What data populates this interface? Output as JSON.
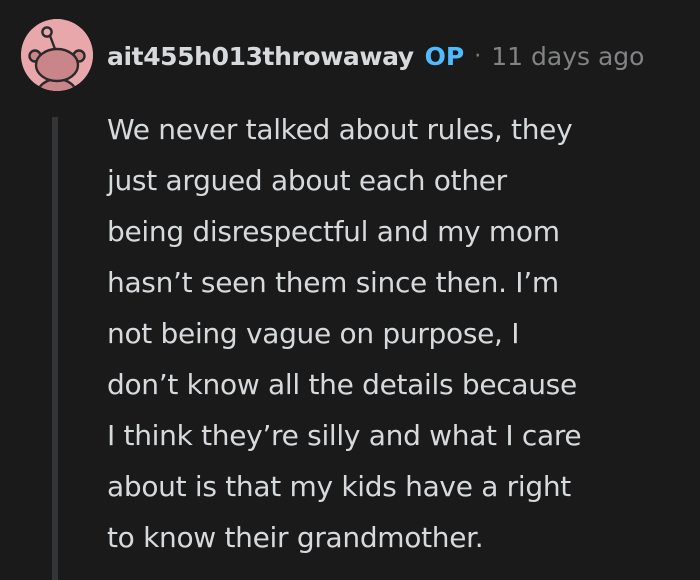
{
  "comment": {
    "author": "ait455h013throwaway",
    "badge": "OP",
    "separator": "·",
    "timestamp": "11 days ago",
    "avatar_icon": "reddit-snoo-icon",
    "body_lines": [
      "We never talked about rules, they",
      "just argued about each other",
      "being disrespectful and my mom",
      "hasn’t seen them since then. I’m",
      "not being vague on purpose, I",
      "don’t know all the details because",
      "I think they’re silly and what I care",
      "about is that my kids have a right",
      "to know their grandmother."
    ]
  },
  "colors": {
    "background": "#1a1a1b",
    "text": "#d7dadc",
    "meta": "#818384",
    "op_badge": "#4fbcff",
    "thread_line": "#343536",
    "avatar_bg": "#e8a7ab"
  }
}
